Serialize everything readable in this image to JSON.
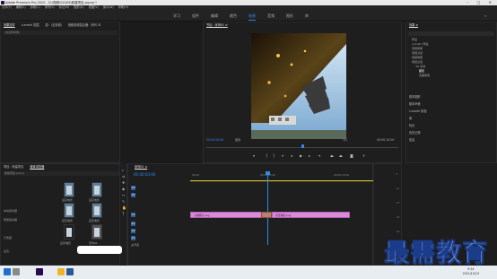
{
  "app": {
    "title": "Adobe Premiere Pro 2020 - D:\\视频\\02005\\新建项目.prproj *",
    "window_buttons": "–  □  ✕"
  },
  "menu": [
    "文件(F)",
    "编辑(E)",
    "剪辑(C)",
    "序列(S)",
    "标记(M)",
    "图形(G)",
    "视图(V)",
    "窗口(W)",
    "帮助(H)"
  ],
  "workspaces": [
    "学习",
    "组件",
    "编辑",
    "颜色",
    "效果",
    "音频",
    "图形",
    "库"
  ],
  "source_panel": {
    "tabs": [
      "效果控件",
      "Lumetri 范围",
      "源：(无剪辑)",
      "音频剪辑混合器：序列 01"
    ],
    "no_clip": "(未选择剪辑)",
    "timecode": "00;00;00;00"
  },
  "program_panel": {
    "tab": "节目：序列01 ≡",
    "timecode": "00:00:00:00",
    "fit": "适合",
    "resolution": "1/2",
    "duration": "00:00:10:00"
  },
  "effects_panel": {
    "tab": "效果 ≡",
    "search_placeholder": "",
    "tree": [
      "预设",
      "Lumetri 预设",
      "音频效果",
      "音频过渡",
      "视频效果",
      "视频过渡",
      "3D 运动",
      "翻页",
      "页面剥落"
    ],
    "sections": [
      "基本图形",
      "基本声音",
      "Lumetri 颜色",
      "库",
      "标记",
      "历史记录",
      "信息"
    ]
  },
  "project_panel": {
    "tabs": [
      "项目：新建项目",
      "媒体浏览器"
    ],
    "path": "新建项目.prproj",
    "items": [
      {
        "label": "豆花电影"
      },
      {
        "label": "豆花电影"
      },
      {
        "label": "豆花电影"
      },
      {
        "label": "豆花电影"
      },
      {
        "label": "豆花电影"
      },
      {
        "label": "序列01"
      }
    ],
    "side_labels": [
      "本地驱动器",
      "网络驱动器",
      "已收藏",
      "最近"
    ]
  },
  "timeline": {
    "tab": "序列01 ≡",
    "timecode": "00:00:03:00",
    "ruler_labels": [
      "00:00",
      "00:00:05:00",
      "00:00:10:00"
    ],
    "tracks": [
      "V3",
      "V2",
      "V1",
      "A1",
      "A2",
      "A3"
    ],
    "master": "主声道",
    "clips": [
      {
        "label": "小猪佩奇.png"
      },
      {
        "label": "豆花电影.png"
      }
    ]
  },
  "meters": {
    "scale": [
      "0",
      "-12",
      "-24",
      "-36",
      "-48",
      "dB"
    ]
  },
  "watermark": "最需教育",
  "taskbar": {
    "time": "9:24",
    "date": "2021/10/13"
  }
}
